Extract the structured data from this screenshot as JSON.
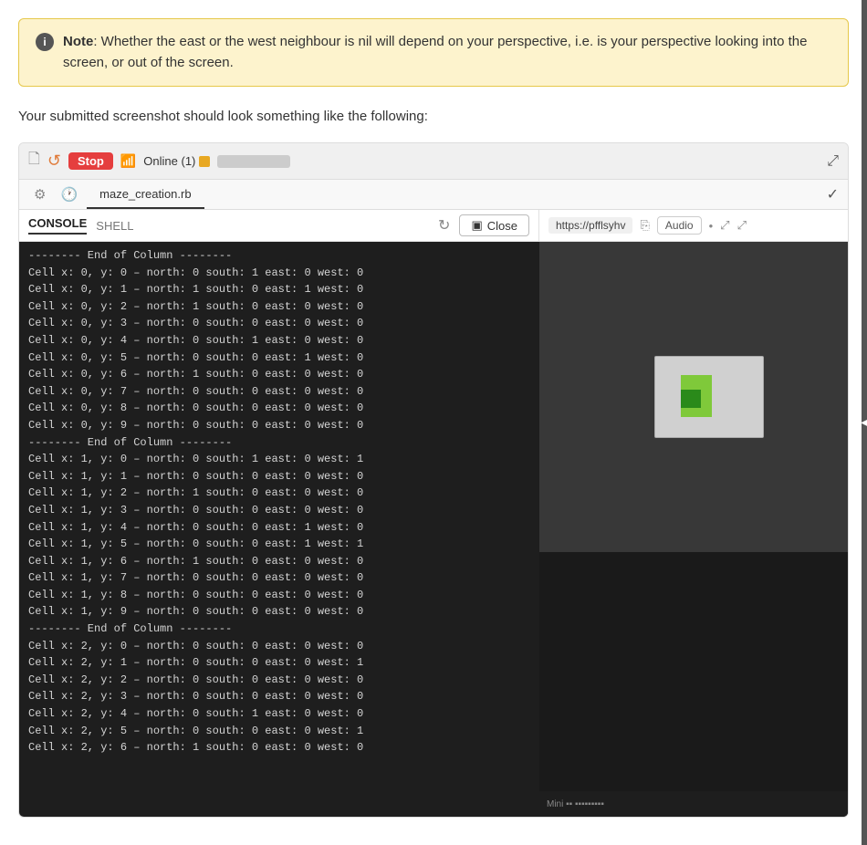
{
  "note": {
    "icon": "i",
    "label_strong": "Note",
    "label_text": ": Whether the east or the west neighbour is nil will depend on your perspective, i.e. is your perspective looking into the screen, or out of the screen."
  },
  "description": "Your submitted screenshot should look something like the following:",
  "toolbar": {
    "stop_label": "Stop",
    "online_label": "Online (1)",
    "expand_icon": "⤢"
  },
  "tabs": {
    "file_icon": "🗋",
    "gear_icon": "⚙",
    "clock_icon": "🕐",
    "file_tab": "maze_creation.rb",
    "checkmark_icon": "✓"
  },
  "console_bar": {
    "console_label": "CONSOLE",
    "shell_label": "SHELL",
    "refresh_icon": "↻",
    "monitor_icon": "▣",
    "close_label": "Close"
  },
  "url_bar": {
    "url": "https://pfflsyhv",
    "copy_icon": "⎘",
    "audio_label": "Audio",
    "dot_icon": "•",
    "external_icon": "⤢",
    "resize_icon": "⤢"
  },
  "console_lines": [
    "-------- End of Column --------",
    "Cell x: 0, y: 0 –  north: 0 south: 1 east: 0 west: 0",
    "Cell x: 0, y: 1 –  north: 1 south: 0 east: 1 west: 0",
    "Cell x: 0, y: 2 –  north: 1 south: 0 east: 0 west: 0",
    "Cell x: 0, y: 3 –  north: 0 south: 0 east: 0 west: 0",
    "Cell x: 0, y: 4 –  north: 0 south: 1 east: 0 west: 0",
    "Cell x: 0, y: 5 –  north: 0 south: 0 east: 1 west: 0",
    "Cell x: 0, y: 6 –  north: 1 south: 0 east: 0 west: 0",
    "Cell x: 0, y: 7 –  north: 0 south: 0 east: 0 west: 0",
    "Cell x: 0, y: 8 –  north: 0 south: 0 east: 0 west: 0",
    "Cell x: 0, y: 9 –  north: 0 south: 0 east: 0 west: 0",
    "-------- End of Column --------",
    "Cell x: 1, y: 0 –  north: 0 south: 1 east: 0 west: 1",
    "Cell x: 1, y: 1 –  north: 0 south: 0 east: 0 west: 0",
    "Cell x: 1, y: 2 –  north: 1 south: 0 east: 0 west: 0",
    "Cell x: 1, y: 3 –  north: 0 south: 0 east: 0 west: 0",
    "Cell x: 1, y: 4 –  north: 0 south: 0 east: 1 west: 0",
    "Cell x: 1, y: 5 –  north: 0 south: 0 east: 1 west: 1",
    "Cell x: 1, y: 6 –  north: 1 south: 0 east: 0 west: 0",
    "Cell x: 1, y: 7 –  north: 0 south: 0 east: 0 west: 0",
    "Cell x: 1, y: 8 –  north: 0 south: 0 east: 0 west: 0",
    "Cell x: 1, y: 9 –  north: 0 south: 0 east: 0 west: 0",
    "-------- End of Column --------",
    "Cell x: 2, y: 0 –  north: 0 south: 0 east: 0 west: 0",
    "Cell x: 2, y: 1 –  north: 0 south: 0 east: 0 west: 1",
    "Cell x: 2, y: 2 –  north: 0 south: 0 east: 0 west: 0",
    "Cell x: 2, y: 3 –  north: 0 south: 0 east: 0 west: 0",
    "Cell x: 2, y: 4 –  north: 0 south: 1 east: 0 west: 0",
    "Cell x: 2, y: 5 –  north: 0 south: 0 east: 0 west: 1",
    "Cell x: 2, y: 6 –  north: 1 south: 0 east: 0 west: 0"
  ]
}
